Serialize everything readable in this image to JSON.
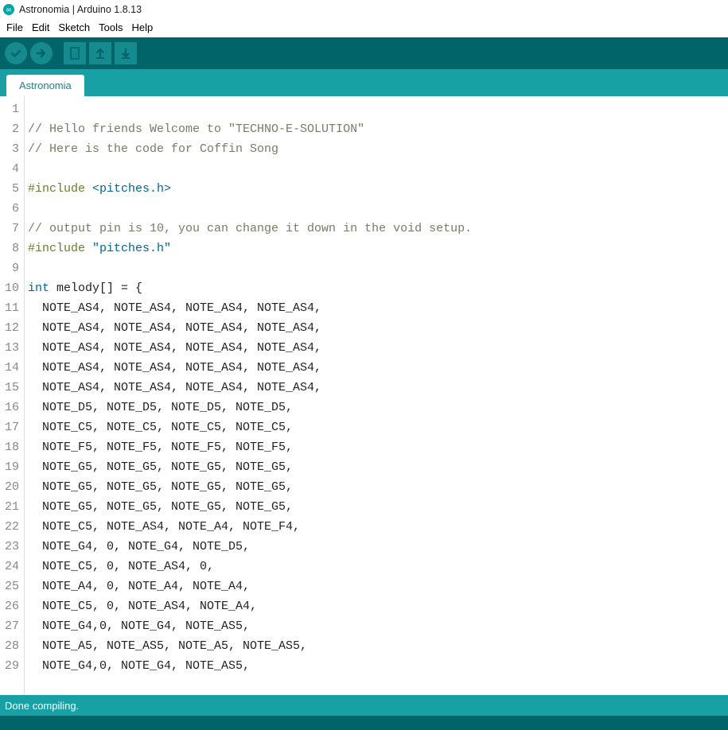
{
  "window": {
    "title": "Astronomia | Arduino 1.8.13"
  },
  "menubar": [
    "File",
    "Edit",
    "Sketch",
    "Tools",
    "Help"
  ],
  "toolbar": {
    "buttons": [
      "verify",
      "upload",
      "new",
      "open",
      "save"
    ]
  },
  "tab": {
    "label": "Astronomia"
  },
  "status": {
    "text": "Done compiling."
  },
  "code": {
    "lines": [
      {
        "n": 1,
        "t": []
      },
      {
        "n": 2,
        "t": [
          [
            "comment",
            "// Hello friends Welcome to \"TECHNO-E-SOLUTION\""
          ]
        ]
      },
      {
        "n": 3,
        "t": [
          [
            "comment",
            "// Here is the code for Coffin Song"
          ]
        ]
      },
      {
        "n": 4,
        "t": []
      },
      {
        "n": 5,
        "t": [
          [
            "pre",
            "#include "
          ],
          [
            "hdr",
            "<pitches.h>"
          ]
        ]
      },
      {
        "n": 6,
        "t": []
      },
      {
        "n": 7,
        "t": [
          [
            "comment",
            "// output pin is 10, you can change it down in the void setup."
          ]
        ]
      },
      {
        "n": 8,
        "t": [
          [
            "pre",
            "#include "
          ],
          [
            "str",
            "\"pitches.h\""
          ]
        ]
      },
      {
        "n": 9,
        "t": []
      },
      {
        "n": 10,
        "t": [
          [
            "type",
            "int"
          ],
          [
            "plain",
            " melody[] = {"
          ]
        ]
      },
      {
        "n": 11,
        "t": [
          [
            "plain",
            "  NOTE_AS4, NOTE_AS4, NOTE_AS4, NOTE_AS4,"
          ]
        ]
      },
      {
        "n": 12,
        "t": [
          [
            "plain",
            "  NOTE_AS4, NOTE_AS4, NOTE_AS4, NOTE_AS4,"
          ]
        ]
      },
      {
        "n": 13,
        "t": [
          [
            "plain",
            "  NOTE_AS4, NOTE_AS4, NOTE_AS4, NOTE_AS4,"
          ]
        ]
      },
      {
        "n": 14,
        "t": [
          [
            "plain",
            "  NOTE_AS4, NOTE_AS4, NOTE_AS4, NOTE_AS4,"
          ]
        ]
      },
      {
        "n": 15,
        "t": [
          [
            "plain",
            "  NOTE_AS4, NOTE_AS4, NOTE_AS4, NOTE_AS4,"
          ]
        ]
      },
      {
        "n": 16,
        "t": [
          [
            "plain",
            "  NOTE_D5, NOTE_D5, NOTE_D5, NOTE_D5,"
          ]
        ]
      },
      {
        "n": 17,
        "t": [
          [
            "plain",
            "  NOTE_C5, NOTE_C5, NOTE_C5, NOTE_C5,"
          ]
        ]
      },
      {
        "n": 18,
        "t": [
          [
            "plain",
            "  NOTE_F5, NOTE_F5, NOTE_F5, NOTE_F5,"
          ]
        ]
      },
      {
        "n": 19,
        "t": [
          [
            "plain",
            "  NOTE_G5, NOTE_G5, NOTE_G5, NOTE_G5,"
          ]
        ]
      },
      {
        "n": 20,
        "t": [
          [
            "plain",
            "  NOTE_G5, NOTE_G5, NOTE_G5, NOTE_G5,"
          ]
        ]
      },
      {
        "n": 21,
        "t": [
          [
            "plain",
            "  NOTE_G5, NOTE_G5, NOTE_G5, NOTE_G5,"
          ]
        ]
      },
      {
        "n": 22,
        "t": [
          [
            "plain",
            "  NOTE_C5, NOTE_AS4, NOTE_A4, NOTE_F4,"
          ]
        ]
      },
      {
        "n": 23,
        "t": [
          [
            "plain",
            "  NOTE_G4, 0, NOTE_G4, NOTE_D5,"
          ]
        ]
      },
      {
        "n": 24,
        "t": [
          [
            "plain",
            "  NOTE_C5, 0, NOTE_AS4, 0,"
          ]
        ]
      },
      {
        "n": 25,
        "t": [
          [
            "plain",
            "  NOTE_A4, 0, NOTE_A4, NOTE_A4,"
          ]
        ]
      },
      {
        "n": 26,
        "t": [
          [
            "plain",
            "  NOTE_C5, 0, NOTE_AS4, NOTE_A4,"
          ]
        ]
      },
      {
        "n": 27,
        "t": [
          [
            "plain",
            "  NOTE_G4,0, NOTE_G4, NOTE_AS5,"
          ]
        ]
      },
      {
        "n": 28,
        "t": [
          [
            "plain",
            "  NOTE_A5, NOTE_AS5, NOTE_A5, NOTE_AS5,"
          ]
        ]
      },
      {
        "n": 29,
        "t": [
          [
            "plain",
            "  NOTE_G4,0, NOTE_G4, NOTE_AS5,"
          ]
        ]
      }
    ]
  }
}
